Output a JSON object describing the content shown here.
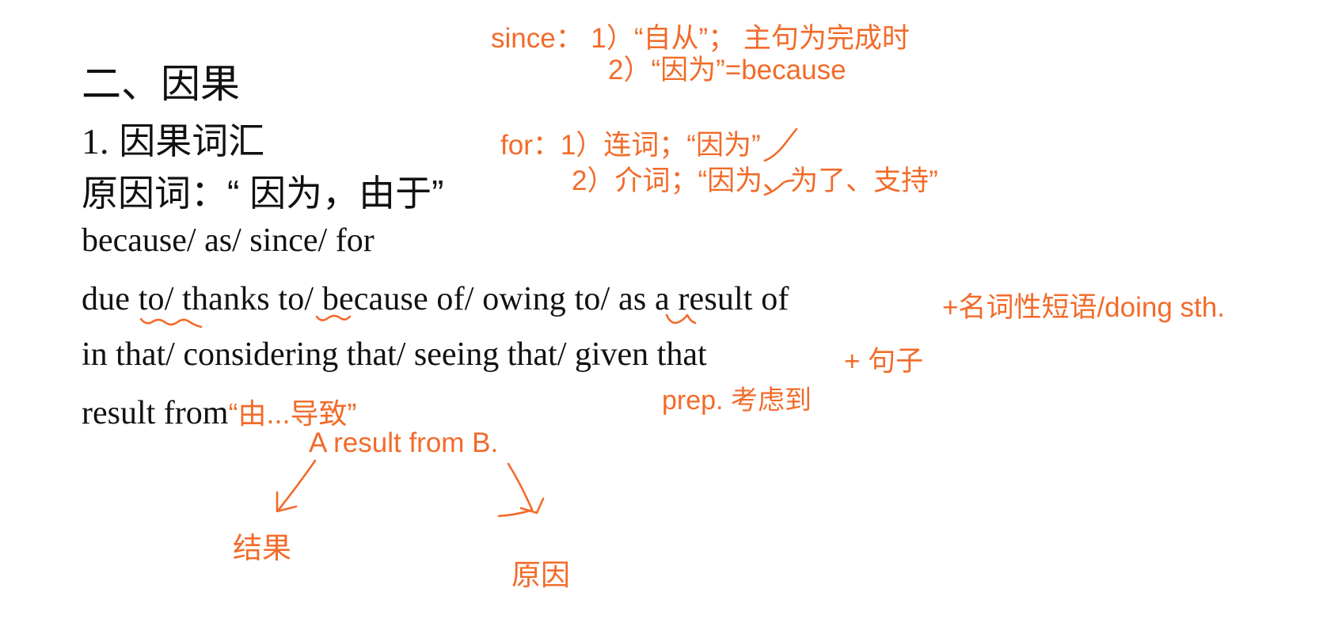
{
  "slide": {
    "heading": "二、因果",
    "subheading_num": "1.",
    "subheading": "因果词汇",
    "cause_label": "原因词：“ 因为，由于”",
    "lines": {
      "l1": "because/ as/ since/ for",
      "l2": "due to/ thanks to/ because of/ owing to/ as a result of",
      "l3": "in that/ considering that/ seeing that/ given that",
      "l4": "result from"
    }
  },
  "annotations": {
    "since_1": "since： 1）“自从”； 主句为完成时",
    "since_2": "2）“因为”=because",
    "for_1": "for：1）连词；“因为”",
    "for_2": "2）介词；“因为、为了、支持”",
    "phrase_note": "+名词性短语/doing sth.",
    "clause_note": "+ 句子",
    "given_note": "prep. 考虑到",
    "result_from_meaning": "“由...导致”",
    "example": "A result from B.",
    "result_label": "结果",
    "cause_label": "原因"
  },
  "colors": {
    "annotation": "#f26b2a",
    "text": "#111111",
    "background": "#ffffff"
  }
}
